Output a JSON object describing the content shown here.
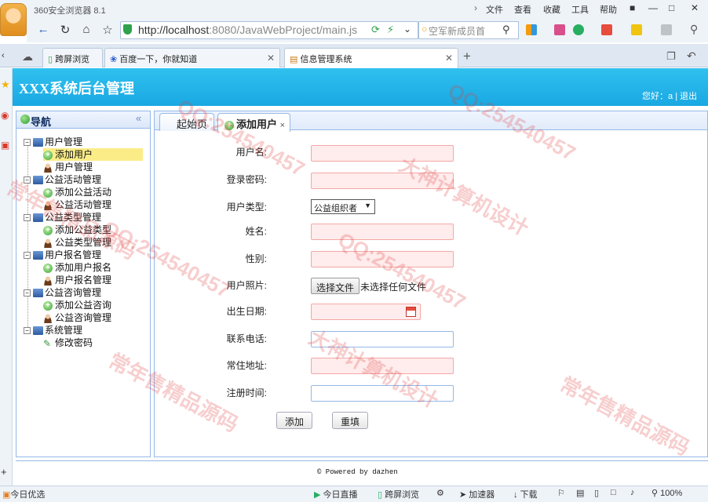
{
  "browser": {
    "app_name": "360安全浏览器 8.1",
    "menu": [
      "文件",
      "查看",
      "收藏",
      "工具",
      "帮助"
    ],
    "window_buttons": [
      "—",
      "□",
      "✕"
    ],
    "url_host": "http://localhost",
    "url_rest": ":8080/JavaWebProject/main.js",
    "search_text": "空军新成员首",
    "tabs": [
      {
        "label": "跨屏浏览"
      },
      {
        "label": "百度一下，你就知道"
      },
      {
        "label": "信息管理系统"
      }
    ],
    "new_tab": "+"
  },
  "app": {
    "title": "XXX系统后台管理",
    "greeting": "您好：a",
    "separator": "|",
    "logout": "退出"
  },
  "nav": {
    "title": "导航",
    "collapse": "«",
    "groups": [
      {
        "label": "用户管理",
        "items": [
          "添加用户",
          "用户管理"
        ]
      },
      {
        "label": "公益活动管理",
        "items": [
          "添加公益活动",
          "公益活动管理"
        ]
      },
      {
        "label": "公益类型管理",
        "items": [
          "添加公益类型",
          "公益类型管理"
        ]
      },
      {
        "label": "用户报名管理",
        "items": [
          "添加用户报名",
          "用户报名管理"
        ]
      },
      {
        "label": "公益咨询管理",
        "items": [
          "添加公益咨询",
          "公益咨询管理"
        ]
      },
      {
        "label": "系统管理",
        "items": [
          "修改密码"
        ]
      }
    ]
  },
  "content": {
    "tabs": [
      {
        "label": "起始页"
      },
      {
        "label": "添加用户"
      }
    ],
    "tab_close": "×",
    "form": {
      "username_label": "用户名:",
      "password_label": "登录密码:",
      "usertype_label": "用户类型:",
      "usertype_value": "公益组织者",
      "name_label": "姓名:",
      "gender_label": "性别:",
      "photo_label": "用户照片:",
      "file_button": "选择文件",
      "file_status": "未选择任何文件",
      "birthday_label": "出生日期:",
      "phone_label": "联系电话:",
      "address_label": "常住地址:",
      "regtime_label": "注册时间:",
      "add_button": "添加",
      "reset_button": "重填"
    }
  },
  "footer": {
    "text": "© Powered by dazhen"
  },
  "statusbar": {
    "left": "今日优选",
    "items": [
      "今日直播",
      "跨屏浏览",
      "加速器",
      "下载"
    ],
    "zoom": "100%"
  },
  "watermark": {
    "lines": [
      "QQ:254540457",
      "大神计算机设计",
      "常年售精品源码"
    ]
  }
}
